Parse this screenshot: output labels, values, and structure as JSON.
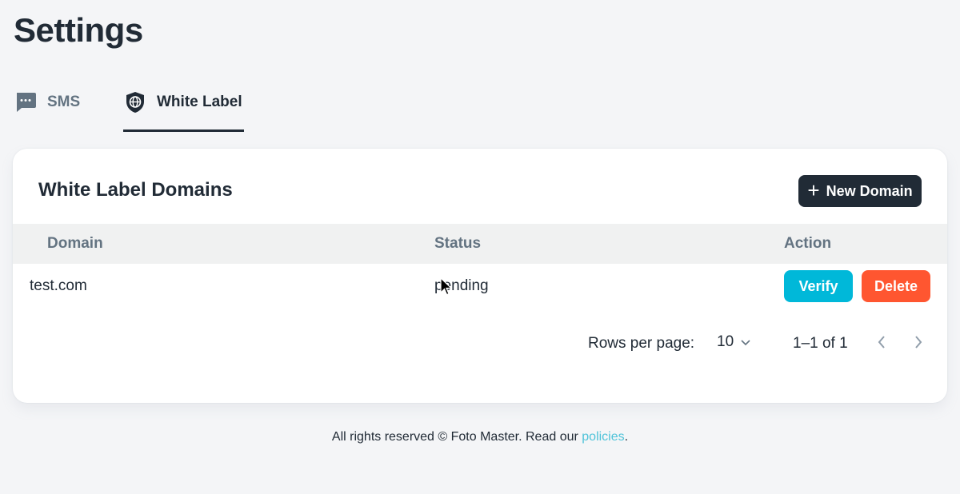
{
  "page": {
    "title": "Settings"
  },
  "tabs": [
    {
      "label": "SMS",
      "icon": "chat-dots-icon",
      "active": false
    },
    {
      "label": "White Label",
      "icon": "globe-shield-icon",
      "active": true
    }
  ],
  "card": {
    "title": "White Label Domains",
    "new_button_label": "New Domain",
    "new_button_icon": "plus-icon"
  },
  "table": {
    "columns": [
      "Domain",
      "Status",
      "Action"
    ],
    "rows": [
      {
        "domain": "test.com",
        "status": "pending",
        "verify_label": "Verify",
        "delete_label": "Delete"
      }
    ]
  },
  "pagination": {
    "rows_per_page_label": "Rows per page:",
    "rows_per_page_value": "10",
    "range": "1–1 of 1"
  },
  "footer": {
    "text": "All rights reserved © Foto Master. Read our ",
    "link_text": "policies",
    "suffix": "."
  },
  "colors": {
    "accent_dark": "#212b36",
    "verify": "#00b8d9",
    "delete": "#ff5630",
    "link": "#4fc3d9",
    "muted": "#637381"
  }
}
